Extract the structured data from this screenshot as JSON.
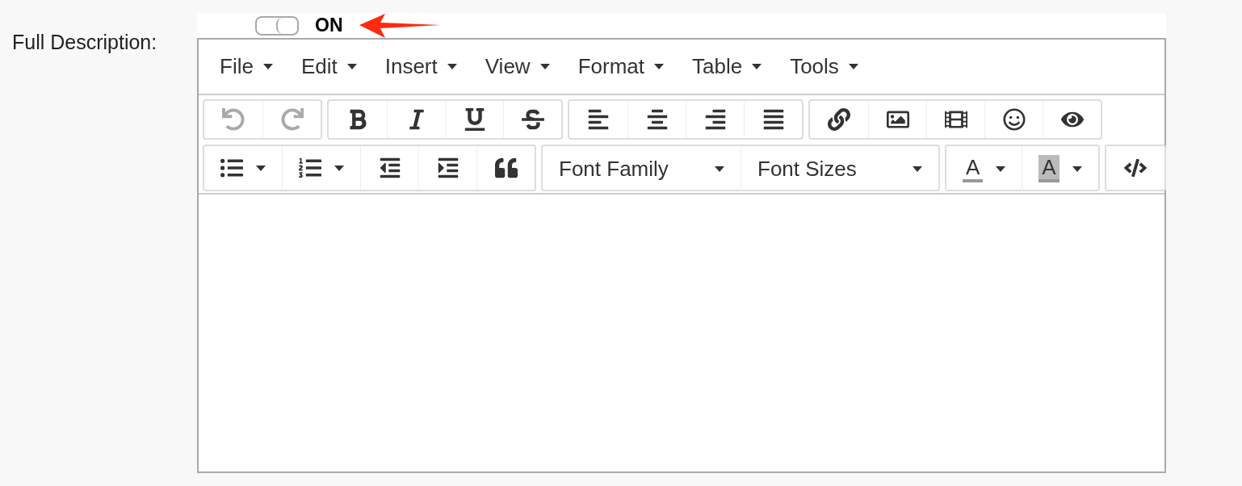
{
  "field_label": "Full Description:",
  "toggle": {
    "on": true,
    "label": "ON"
  },
  "menu": [
    {
      "label": "File"
    },
    {
      "label": "Edit"
    },
    {
      "label": "Insert"
    },
    {
      "label": "View"
    },
    {
      "label": "Format"
    },
    {
      "label": "Table"
    },
    {
      "label": "Tools"
    }
  ],
  "toolbar_rows": [
    [
      [
        {
          "kind": "undo",
          "disabled": true
        },
        {
          "kind": "redo",
          "disabled": true
        }
      ],
      [
        {
          "kind": "bold",
          "disabled": false
        },
        {
          "kind": "italic",
          "disabled": false
        },
        {
          "kind": "underline",
          "disabled": false
        },
        {
          "kind": "strikethrough",
          "disabled": false
        }
      ],
      [
        {
          "kind": "align-left",
          "disabled": false
        },
        {
          "kind": "align-center",
          "disabled": false
        },
        {
          "kind": "align-right",
          "disabled": false
        },
        {
          "kind": "justify",
          "disabled": false
        }
      ],
      [
        {
          "kind": "link",
          "disabled": false
        },
        {
          "kind": "image",
          "disabled": false
        },
        {
          "kind": "video",
          "disabled": false
        },
        {
          "kind": "emoticon",
          "disabled": false
        },
        {
          "kind": "preview",
          "disabled": false
        }
      ]
    ],
    [
      [
        {
          "kind": "bullet-list",
          "disabled": false
        },
        {
          "kind": "numbered-list",
          "disabled": false
        },
        {
          "kind": "outdent",
          "disabled": false
        },
        {
          "kind": "indent",
          "disabled": false
        },
        {
          "kind": "blockquote",
          "disabled": false
        }
      ],
      [
        {
          "kind": "dropdown",
          "label": "Font Family"
        },
        {
          "kind": "dropdown",
          "label": "Font Sizes"
        }
      ],
      [
        {
          "kind": "text-color",
          "letter": "A"
        },
        {
          "kind": "highlight-color",
          "letter": "A"
        }
      ],
      [
        {
          "kind": "code",
          "disabled": false
        }
      ]
    ]
  ]
}
